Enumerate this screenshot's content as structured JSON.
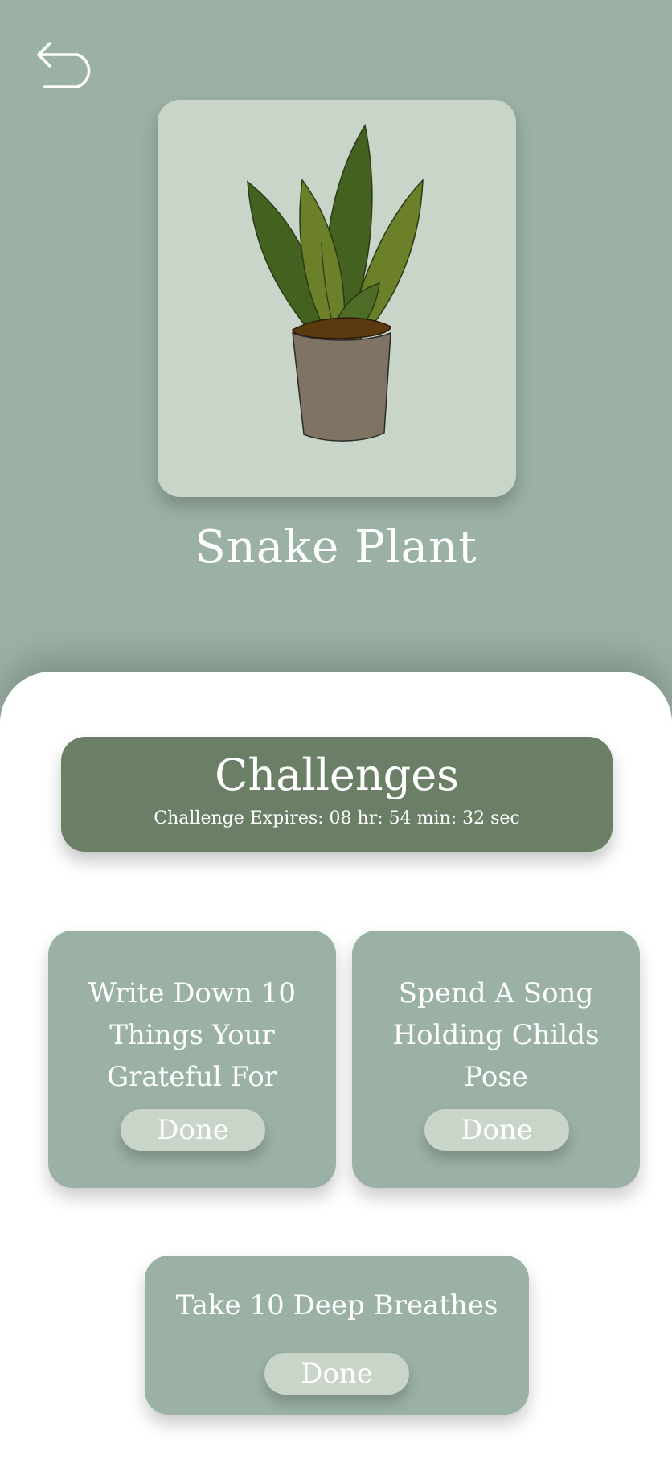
{
  "plant": {
    "name": "Snake Plant",
    "illustration": "snake-plant-in-pot"
  },
  "navigation": {
    "back_icon": "back-arrow-icon"
  },
  "challenges": {
    "title": "Challenges",
    "expires": "Challenge Expires: 08 hr: 54 min: 32 sec",
    "tasks": [
      {
        "line1": "Write Down 10",
        "line2": "Things Your",
        "line3": "Grateful For",
        "button": "Done"
      },
      {
        "line1": "Spend A Song",
        "line2": "Holding Childs",
        "line3": "Pose",
        "button": "Done"
      },
      {
        "line1": "Take 10 Deep Breathes",
        "button": "Done"
      }
    ]
  },
  "colors": {
    "background": "#9bb1a6",
    "card_light": "#cad5c9",
    "header_dark": "#6b7f66",
    "sheet": "#ffffff",
    "text": "#ffffff"
  }
}
